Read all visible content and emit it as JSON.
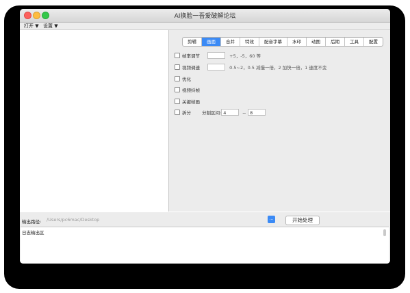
{
  "window": {
    "title": "AI换脸一吾爱破解论坛"
  },
  "menubar": {
    "items": [
      "打开 ▼",
      "设置 ▼"
    ]
  },
  "tabs": {
    "items": [
      "剪辑",
      "画面",
      "合并",
      "特效",
      "配音字幕",
      "水印",
      "动图",
      "后期",
      "工具",
      "配置"
    ],
    "active_index": 1
  },
  "options": {
    "speed": {
      "label": "帧率调节",
      "value": "",
      "hint": "+5，-5，60 等"
    },
    "playback": {
      "label": "视频调速",
      "value": "",
      "hint": "0.5~2，0.5 减慢一倍，2 加快一倍，1 速度不变"
    },
    "optimize": {
      "label": "优化"
    },
    "deshake": {
      "label": "视频抖帧"
    },
    "keyframe": {
      "label": "关键帧画"
    },
    "split": {
      "label": "拆分",
      "range_label": "分割区间:",
      "from": "4",
      "separator": "--",
      "to": "8"
    }
  },
  "output": {
    "label": "输出路径:",
    "path": "/Users/pc6mac/Desktop",
    "browse_label": "...",
    "start_label": "开始处理"
  },
  "log": {
    "label": "日志输出区"
  },
  "colors": {
    "accent": "#3b8af5",
    "close": "#fc605c",
    "minimize": "#fdbc40",
    "maximize": "#34c84a"
  }
}
